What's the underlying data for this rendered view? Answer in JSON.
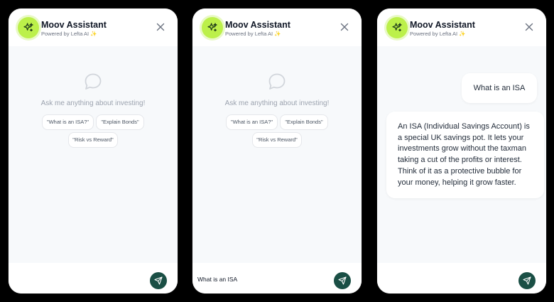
{
  "header": {
    "title": "Moov Assistant",
    "subtitle": "Powered by Lefta AI ✨"
  },
  "icons": {
    "avatar": "sparkles-icon",
    "close": "close-icon",
    "empty": "chat-bubble-icon",
    "send": "send-icon"
  },
  "empty_state": {
    "prompt": "Ask me anything about investing!",
    "suggestions": [
      "\"What is an ISA?\"",
      "\"Explain Bonds\"",
      "\"Risk vs Reward\""
    ]
  },
  "panels": {
    "p1_input": "",
    "p2_input": "What is an ISA",
    "p3_input": ""
  },
  "conversation": {
    "user": "What is an ISA",
    "assistant": "An ISA (Individual Savings Account) is a special UK savings pot. It lets your investments grow without the taxman taking a cut of the profits or interest.\nThink of it as a protective bubble for your money, helping it grow faster."
  },
  "colors": {
    "accent": "#bcf04a",
    "send_button": "#1a4f45",
    "panel_bg": "#f7f9fb",
    "page_bg": "#000000"
  }
}
